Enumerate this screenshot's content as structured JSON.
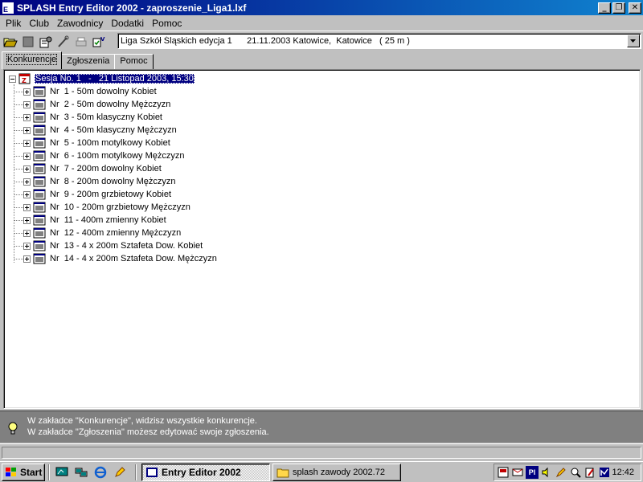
{
  "window": {
    "title": "SPLASH Entry Editor 2002 - zaproszenie_Liga1.lxf",
    "minimize_label": "_",
    "maximize_label": "❐",
    "close_label": "✕"
  },
  "menu": {
    "items": [
      {
        "label": "Plik"
      },
      {
        "label": "Club"
      },
      {
        "label": "Zawodnicy"
      },
      {
        "label": "Dodatki"
      },
      {
        "label": "Pomoc"
      }
    ]
  },
  "toolbar": {
    "competition_selector": "Liga Szkół Śląskich edycja 1      21.11.2003 Katowice,  Katowice   ( 25 m )"
  },
  "tabs": [
    {
      "label": "Konkurencje",
      "active": true
    },
    {
      "label": "Zgłoszenia",
      "active": false
    },
    {
      "label": "Pomoc",
      "active": false
    }
  ],
  "tree": {
    "session": "Sesja No. 1   -   21 Listopad 2003, 15:30",
    "events": [
      "Nr  1 - 50m dowolny Kobiet",
      "Nr  2 - 50m dowolny Mężczyzn",
      "Nr  3 - 50m klasyczny Kobiet",
      "Nr  4 - 50m klasyczny Mężczyzn",
      "Nr  5 - 100m motylkowy Kobiet",
      "Nr  6 - 100m motylkowy Mężczyzn",
      "Nr  7 - 200m dowolny Kobiet",
      "Nr  8 - 200m dowolny Mężczyzn",
      "Nr  9 - 200m grzbietowy Kobiet",
      "Nr  10 - 200m grzbietowy Mężczyzn",
      "Nr  11 - 400m zmienny Kobiet",
      "Nr  12 - 400m zmienny Mężczyzn",
      "Nr  13 - 4 x 200m Sztafeta Dow. Kobiet",
      "Nr  14 - 4 x 200m Sztafeta Dow. Mężczyzn"
    ]
  },
  "info": {
    "line1": "W zakładce \"Konkurencje\", widzisz wszystkie konkurencje.",
    "line2": "W zakładce \"Zgłoszenia\" możesz edytować swoje zgłoszenia."
  },
  "taskbar": {
    "start_label": "Start",
    "tasks": [
      {
        "label": "Entry Editor 2002",
        "active": true
      },
      {
        "label": "splash zawody 2002.72",
        "active": false
      }
    ],
    "tray_language": "Pl",
    "clock": "12:42"
  },
  "colors": {
    "title_start": "#000080",
    "title_end": "#1084d0",
    "selection": "#000080",
    "face": "#c0c0c0",
    "info_bg": "#808080"
  }
}
